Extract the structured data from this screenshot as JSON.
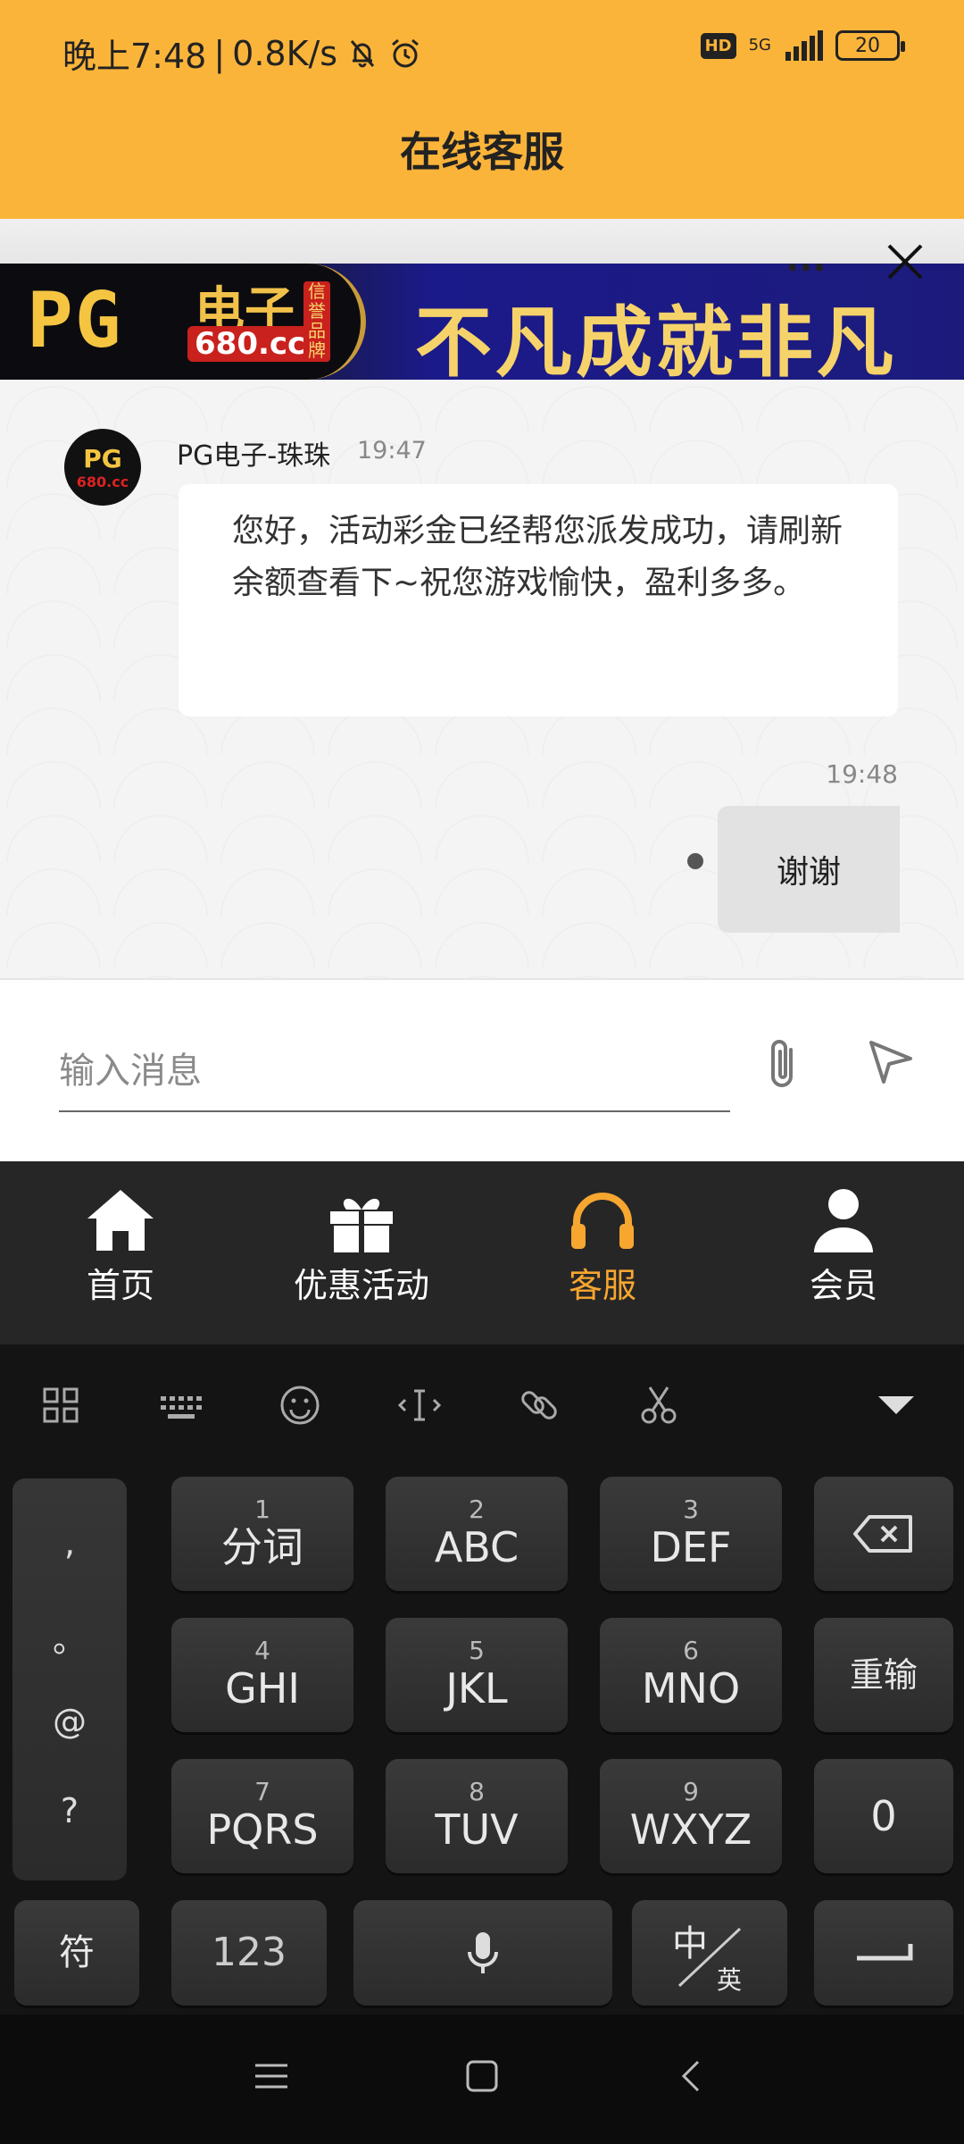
{
  "status_bar": {
    "time": "晚上7:48",
    "speed": "0.8K/s",
    "hd": "HD",
    "network": "5G",
    "battery": "20"
  },
  "header": {
    "title": "在线客服"
  },
  "banner": {
    "logo": "PG",
    "logo_cn": "电子",
    "url": "680.cc",
    "seal": "信誉品牌",
    "slogan": "不凡成就非凡",
    "more": "···"
  },
  "chat": {
    "incoming": {
      "avatar_text": "PG",
      "avatar_sub": "680.cc",
      "sender": "PG电子-珠珠",
      "time": "19:47",
      "text": "您好，活动彩金已经帮您派发成功，请刷新余额查看下~祝您游戏愉快，盈利多多。"
    },
    "outgoing": {
      "time": "19:48",
      "text": "谢谢"
    }
  },
  "composer": {
    "placeholder": "输入消息"
  },
  "bottom_nav": [
    {
      "label": "首页",
      "icon": "home-icon"
    },
    {
      "label": "优惠活动",
      "icon": "gift-icon"
    },
    {
      "label": "客服",
      "icon": "headset-icon",
      "active": true
    },
    {
      "label": "会员",
      "icon": "user-icon"
    }
  ],
  "keyboard": {
    "punct": [
      ",",
      "。",
      "@",
      "?"
    ],
    "keys": [
      {
        "num": "1",
        "main": "分词"
      },
      {
        "num": "2",
        "main": "ABC"
      },
      {
        "num": "3",
        "main": "DEF"
      },
      {
        "num": "4",
        "main": "GHI"
      },
      {
        "num": "5",
        "main": "JKL"
      },
      {
        "num": "6",
        "main": "MNO"
      },
      {
        "num": "7",
        "main": "PQRS"
      },
      {
        "num": "8",
        "main": "TUV"
      },
      {
        "num": "9",
        "main": "WXYZ"
      }
    ],
    "reinput": "重输",
    "zero": "0",
    "symbols": "符",
    "num123": "123",
    "lang_cn": "中",
    "lang_en": "英"
  },
  "colors": {
    "header": "#FBB43A",
    "nav_active": "#F7A62F",
    "nav_bg": "#262626",
    "keyboard_bg": "#141414"
  }
}
